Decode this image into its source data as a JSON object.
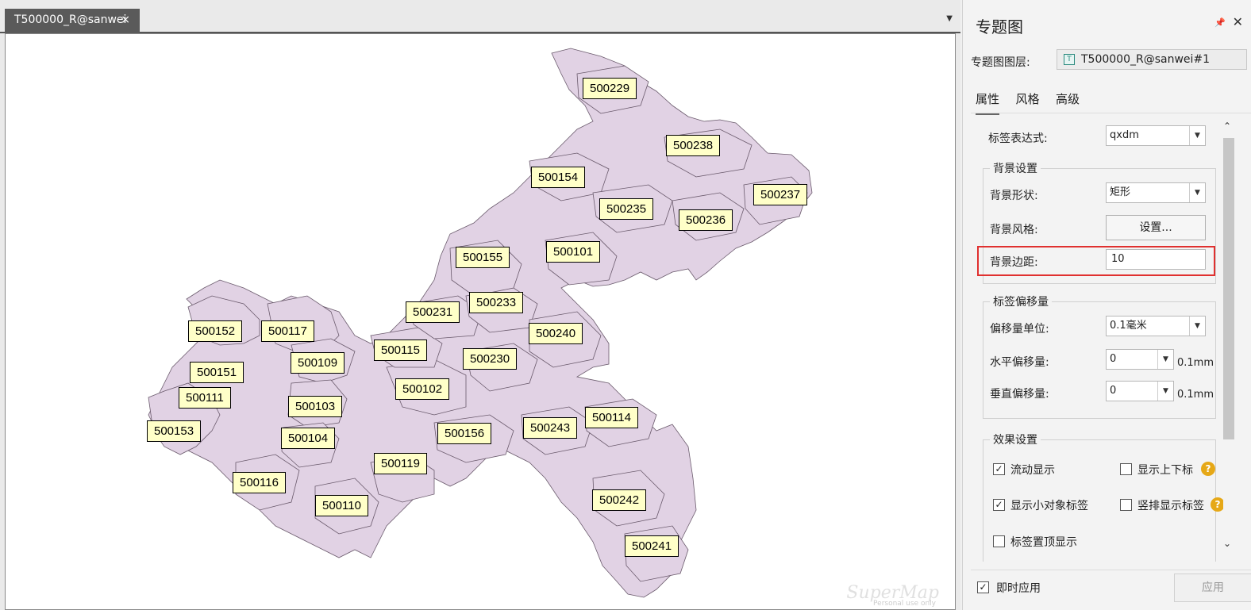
{
  "document_tab": {
    "title": "T500000_R@sanwei",
    "close": "×",
    "dropdown": "▼"
  },
  "map": {
    "fill_color": "#e1d2e4",
    "label_bg": "#ffffc8",
    "labels": [
      "500229",
      "500238",
      "500154",
      "500237",
      "500235",
      "500236",
      "500155",
      "500101",
      "500233",
      "500231",
      "500152",
      "500117",
      "500240",
      "500115",
      "500109",
      "500230",
      "500151",
      "500111",
      "500102",
      "500103",
      "500114",
      "500153",
      "500156",
      "500243",
      "500104",
      "500119",
      "500116",
      "500242",
      "500110",
      "500241"
    ],
    "watermark": "SuperMap",
    "watermark_sub": "Personal use only"
  },
  "panel": {
    "title": "专题图",
    "pin": "📌",
    "close": "✕",
    "layer_label": "专题图图层:",
    "layer_value": "T500000_R@sanwei#1",
    "layer_icon": "T",
    "tabs": [
      "属性",
      "风格",
      "高级"
    ],
    "label_expr": {
      "label": "标签表达式:",
      "value": "qxdm"
    },
    "bg_group": {
      "title": "背景设置",
      "shape": {
        "label": "背景形状:",
        "value": "矩形"
      },
      "style": {
        "label": "背景风格:",
        "button": "设置..."
      },
      "margin": {
        "label": "背景边距:",
        "value": "10"
      }
    },
    "offset_group": {
      "title": "标签偏移量",
      "unit": {
        "label": "偏移量单位:",
        "value": "0.1毫米"
      },
      "horizontal": {
        "label": "水平偏移量:",
        "value": "0",
        "unit": "0.1mm"
      },
      "vertical": {
        "label": "垂直偏移量:",
        "value": "0",
        "unit": "0.1mm"
      }
    },
    "effect_group": {
      "title": "效果设置",
      "flow": {
        "label": "流动显示",
        "checked": true
      },
      "subsup": {
        "label": "显示上下标",
        "checked": false
      },
      "small": {
        "label": "显示小对象标签",
        "checked": true
      },
      "vertical_label": {
        "label": "竖排显示标签",
        "checked": false
      },
      "top": {
        "label": "标签置顶显示",
        "checked": false
      }
    },
    "help": "?",
    "check_mark": "✓",
    "scroll_up": "⌃",
    "scroll_down": "⌄",
    "instant_apply": {
      "label": "即时应用",
      "checked": true
    },
    "apply_button": "应用"
  }
}
